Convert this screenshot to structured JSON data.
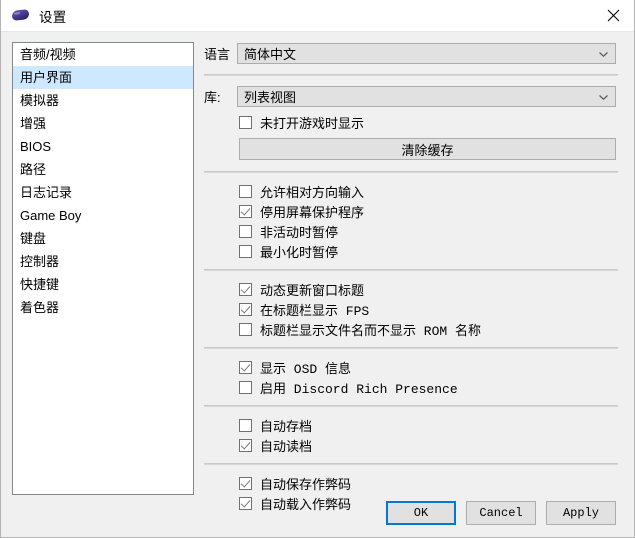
{
  "window": {
    "title": "设置",
    "icon": "gamepad-icon",
    "close_label": "×"
  },
  "sidebar": {
    "items": [
      {
        "label": "音频/视频",
        "selected": false
      },
      {
        "label": "用户界面",
        "selected": true
      },
      {
        "label": "模拟器",
        "selected": false
      },
      {
        "label": "增强",
        "selected": false
      },
      {
        "label": "BIOS",
        "selected": false
      },
      {
        "label": "路径",
        "selected": false
      },
      {
        "label": "日志记录",
        "selected": false
      },
      {
        "label": "Game Boy",
        "selected": false
      },
      {
        "label": "键盘",
        "selected": false
      },
      {
        "label": "控制器",
        "selected": false
      },
      {
        "label": "快捷键",
        "selected": false
      },
      {
        "label": "着色器",
        "selected": false
      }
    ]
  },
  "panel": {
    "language": {
      "label": "语言",
      "value": "简体中文"
    },
    "library": {
      "label": "库:",
      "value": "列表视图"
    },
    "show_when_no_game": {
      "label": "未打开游戏时显示",
      "checked": false
    },
    "clear_cache_button": "清除缓存",
    "group_behavior": [
      {
        "label": "允许相对方向输入",
        "checked": false,
        "mono": false
      },
      {
        "label": "停用屏幕保护程序",
        "checked": true,
        "mono": false
      },
      {
        "label": "非活动时暂停",
        "checked": false,
        "mono": false
      },
      {
        "label": "最小化时暂停",
        "checked": false,
        "mono": false
      }
    ],
    "group_titlebar": [
      {
        "label": "动态更新窗口标题",
        "checked": true,
        "mono": false
      },
      {
        "label": "在标题栏显示 FPS",
        "checked": true,
        "mono": true
      },
      {
        "label": "标题栏显示文件名而不显示 ROM 名称",
        "checked": false,
        "mono": true
      }
    ],
    "group_osd": [
      {
        "label": "显示 OSD 信息",
        "checked": true,
        "mono": true
      },
      {
        "label": "启用 Discord Rich Presence",
        "checked": false,
        "mono": true
      }
    ],
    "group_states": [
      {
        "label": "自动存档",
        "checked": false,
        "mono": false
      },
      {
        "label": "自动读档",
        "checked": true,
        "mono": false
      }
    ],
    "group_cheats": [
      {
        "label": "自动保存作弊码",
        "checked": true,
        "mono": false
      },
      {
        "label": "自动载入作弊码",
        "checked": true,
        "mono": false
      }
    ]
  },
  "footer": {
    "ok": "OK",
    "cancel": "Cancel",
    "apply": "Apply"
  },
  "colors": {
    "selection": "#cde8ff",
    "focus_border": "#0078d7",
    "window_bg": "#f0f0f0"
  }
}
